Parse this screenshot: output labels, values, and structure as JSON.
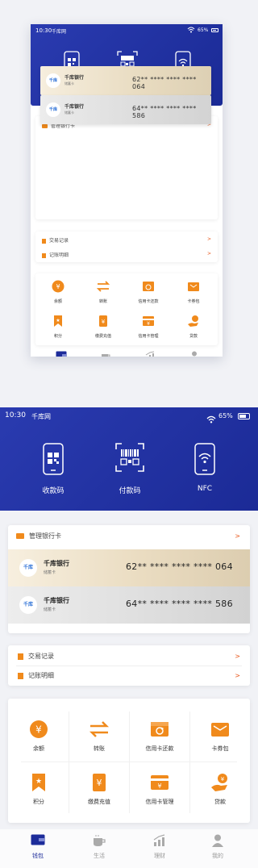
{
  "status": {
    "time": "10:30",
    "carrier": "千库网",
    "battery": "65%"
  },
  "header_actions": [
    {
      "label": "收款码",
      "icon": "phone-qr-icon"
    },
    {
      "label": "付款码",
      "icon": "barcode-scan-icon"
    },
    {
      "label": "NFC",
      "icon": "phone-wifi-icon"
    }
  ],
  "cards_section": {
    "title": "管理银行卡",
    "arrow": ">"
  },
  "cards": [
    {
      "bank": "千库银行",
      "type": "储蓄卡",
      "number": "62** **** **** **** 064",
      "logo": "千库"
    },
    {
      "bank": "千库银行",
      "type": "储蓄卡",
      "number": "64** **** **** **** 586",
      "logo": "千库"
    }
  ],
  "records": [
    {
      "label": "交易记录",
      "arrow": ">"
    },
    {
      "label": "记账明细",
      "arrow": ">"
    }
  ],
  "services": [
    {
      "label": "余额",
      "icon": "yuan-coin-icon"
    },
    {
      "label": "转账",
      "icon": "transfer-arrows-icon"
    },
    {
      "label": "信用卡还款",
      "icon": "card-repay-icon"
    },
    {
      "label": "卡券包",
      "icon": "coupon-wallet-icon"
    },
    {
      "label": "积分",
      "icon": "points-bookmark-icon"
    },
    {
      "label": "缴费充值",
      "icon": "phone-yuan-icon"
    },
    {
      "label": "信用卡管理",
      "icon": "card-yuan-icon"
    },
    {
      "label": "贷款",
      "icon": "hand-coin-icon"
    }
  ],
  "tabs": [
    {
      "label": "钱包",
      "icon": "wallet-icon",
      "active": true
    },
    {
      "label": "生活",
      "icon": "coffee-icon",
      "active": false
    },
    {
      "label": "理财",
      "icon": "chart-icon",
      "active": false
    },
    {
      "label": "我的",
      "icon": "person-icon",
      "active": false
    }
  ],
  "colors": {
    "primary": "#1d2c9a",
    "accent": "#f08a1c",
    "arrow": "#e8571a"
  }
}
